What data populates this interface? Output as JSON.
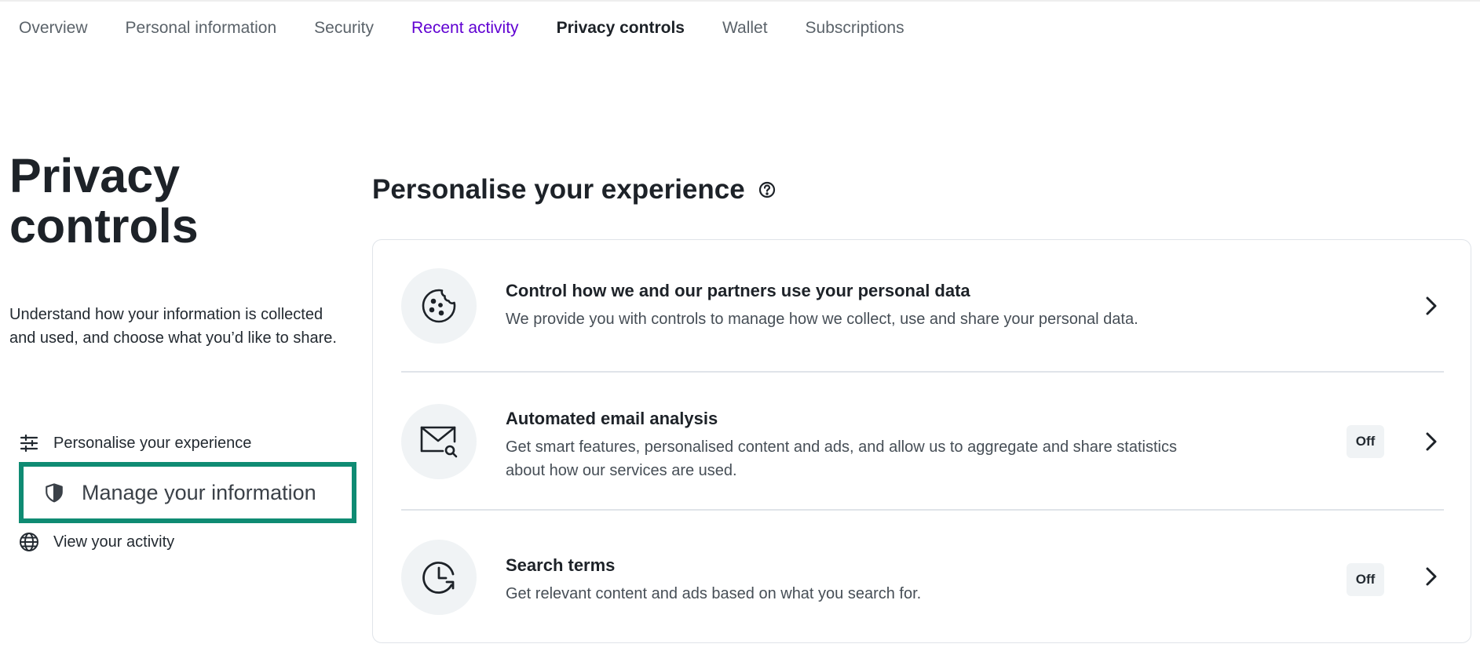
{
  "nav": {
    "tabs": [
      {
        "label": "Overview"
      },
      {
        "label": "Personal information"
      },
      {
        "label": "Security"
      },
      {
        "label": "Recent activity"
      },
      {
        "label": "Privacy controls"
      },
      {
        "label": "Wallet"
      },
      {
        "label": "Subscriptions"
      }
    ],
    "current": "Privacy controls"
  },
  "page": {
    "title": "Privacy controls",
    "intro": "Understand how your information is collected and used, and choose what you’d like to share."
  },
  "side_nav": {
    "items": [
      {
        "label": "Personalise your experience",
        "icon": "sliders-icon"
      },
      {
        "label": "Manage your information",
        "icon": "shield-icon"
      },
      {
        "label": "View your activity",
        "icon": "globe-icon"
      }
    ],
    "active": "Manage your information"
  },
  "section": {
    "title": "Personalise your experience",
    "help_icon": "help-circle-icon"
  },
  "cards": [
    {
      "title": "Control how we and our partners use your personal data",
      "description": "We provide you with controls to manage how we collect, use and share your personal data.",
      "icon": "cookie-icon"
    },
    {
      "title": "Automated email analysis",
      "description": "Get smart features, personalised content and ads, and allow us to aggregate and share statistics about how our services are used.",
      "status": "Off",
      "icon": "mail-search-icon"
    },
    {
      "title": "Search terms",
      "description": "Get relevant content and ads based on what you search for.",
      "status": "Off",
      "icon": "history-icon"
    }
  ],
  "colors": {
    "accent": "#6001d2",
    "highlight_border": "#0f8b73",
    "text": "#1d2228",
    "muted_text": "#5b636a",
    "icon_bg": "#f0f3f5",
    "divider": "#e0e4e9"
  }
}
